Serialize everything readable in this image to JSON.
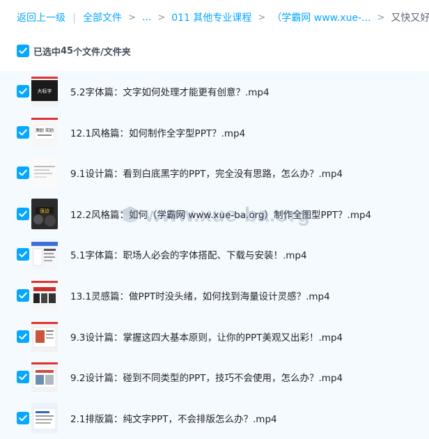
{
  "breadcrumb": {
    "back": "返回上一级",
    "divider": "|",
    "all_files": "全部文件",
    "ellipsis": "...",
    "folder1": "011 其他专业课程",
    "folder2": "（学霸网 www.xue-...",
    "current": "又快又好搞定工",
    "separator": ">"
  },
  "selection": {
    "prefix": "已选中",
    "count": "45",
    "suffix": "个文件/文件夹"
  },
  "files": [
    {
      "name": "5.2字体篇：文字如何处理才能更有创意？.mp4",
      "checked": true,
      "thumb_text": "大标字"
    },
    {
      "name": "12.1风格篇：如何制作全字型PPT？.mp4",
      "checked": true,
      "thumb_text": "激励 奖励"
    },
    {
      "name": "9.1设计篇：看到白底黑字的PPT，完全没有思路，怎么办？.mp4",
      "checked": true,
      "thumb_text": ""
    },
    {
      "name": "12.2风格篇：如何（学霸网 www.xue-ba.org）制作全图型PPT？.mp4",
      "checked": true,
      "thumb_text": "强迫"
    },
    {
      "name": "5.1字体篇：职场人必会的字体搭配、下载与安装！.mp4",
      "checked": true,
      "thumb_text": ""
    },
    {
      "name": "13.1灵感篇：做PPT时没头绪，如何找到海量设计灵感？.mp4",
      "checked": true,
      "thumb_text": ""
    },
    {
      "name": "9.3设计篇：掌握这四大基本原则，让你的PPT美观又出彩！.mp4",
      "checked": true,
      "thumb_text": ""
    },
    {
      "name": "9.2设计篇：碰到不同类型的PPT，技巧不会使用，怎么办？.mp4",
      "checked": true,
      "thumb_text": ""
    },
    {
      "name": "2.1排版篇：纯文字PPT，不会排版怎么办？.mp4",
      "checked": true,
      "thumb_text": ""
    }
  ],
  "watermark": {
    "text": "www.xue-ba.org",
    "icon": "graduation-cap-icon"
  },
  "colors": {
    "accent": "#06a7ff",
    "list_background": "#f5faff",
    "text": "#1f2329"
  }
}
